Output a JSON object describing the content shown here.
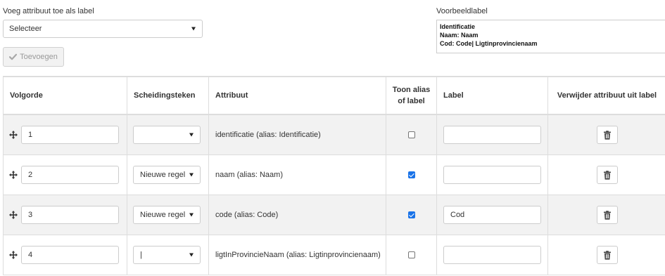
{
  "form": {
    "add_attribute_label": "Voeg attribuut toe als label",
    "attribute_select_value": "Selecteer",
    "add_button_label": "Toevoegen",
    "preview_label": "Voorbeeldlabel",
    "preview_lines": [
      "Identificatie",
      "Naam: Naam",
      "Cod: Code| Ligtinprovincienaam"
    ]
  },
  "table": {
    "headers": {
      "order": "Volgorde",
      "separator": "Scheidingsteken",
      "attribute": "Attribuut",
      "show_alias_line1": "Toon alias",
      "show_alias_line2": "of label",
      "label": "Label",
      "remove": "Verwijder attribuut uit label"
    },
    "rows": [
      {
        "order": "1",
        "separator": "",
        "attribute": "identificatie (alias: Identificatie)",
        "show_alias": false,
        "label": ""
      },
      {
        "order": "2",
        "separator": "Nieuwe regel",
        "attribute": "naam (alias: Naam)",
        "show_alias": true,
        "label": ""
      },
      {
        "order": "3",
        "separator": "Nieuwe regel",
        "attribute": "code (alias: Code)",
        "show_alias": true,
        "label": "Cod"
      },
      {
        "order": "4",
        "separator": "|",
        "attribute": "ligtInProvincieNaam (alias: Ligtinprovincienaam)",
        "show_alias": false,
        "label": ""
      }
    ]
  },
  "icons": {
    "check": "check-icon",
    "move": "move-icon",
    "trash": "trash-icon",
    "caret": "chevron-down-icon"
  },
  "colors": {
    "checkbox_checked": "#1a73e8",
    "row_alt_bg": "#f2f2f2",
    "border": "#dddddd"
  }
}
